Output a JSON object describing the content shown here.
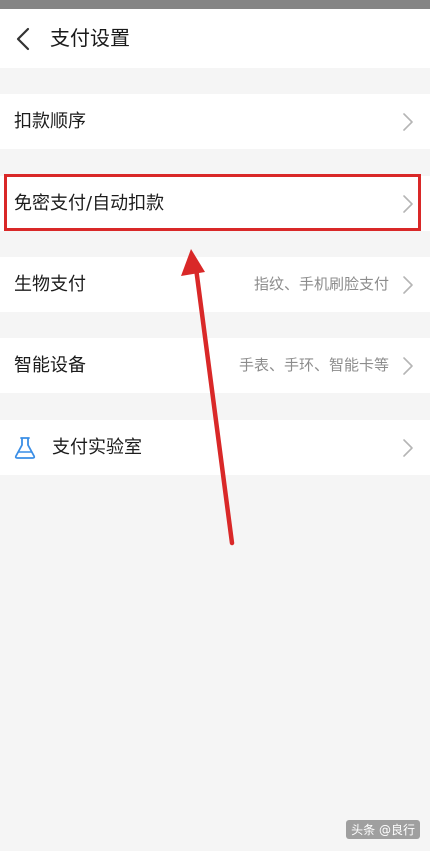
{
  "header": {
    "title": "支付设置"
  },
  "rows": [
    {
      "label": "扣款顺序",
      "value": ""
    },
    {
      "label": "免密支付/自动扣款",
      "value": ""
    },
    {
      "label": "生物支付",
      "value": "指纹、手机刷脸支付"
    },
    {
      "label": "智能设备",
      "value": "手表、手环、智能卡等"
    },
    {
      "label": "支付实验室",
      "value": ""
    }
  ],
  "icons": {
    "back": "chevron-left-icon",
    "chevron": "chevron-right-icon",
    "lab": "flask-icon"
  },
  "colors": {
    "highlight": "#d92828",
    "lab_icon": "#3a8ee6",
    "background": "#f5f5f5"
  },
  "watermark": "头条 @良行"
}
